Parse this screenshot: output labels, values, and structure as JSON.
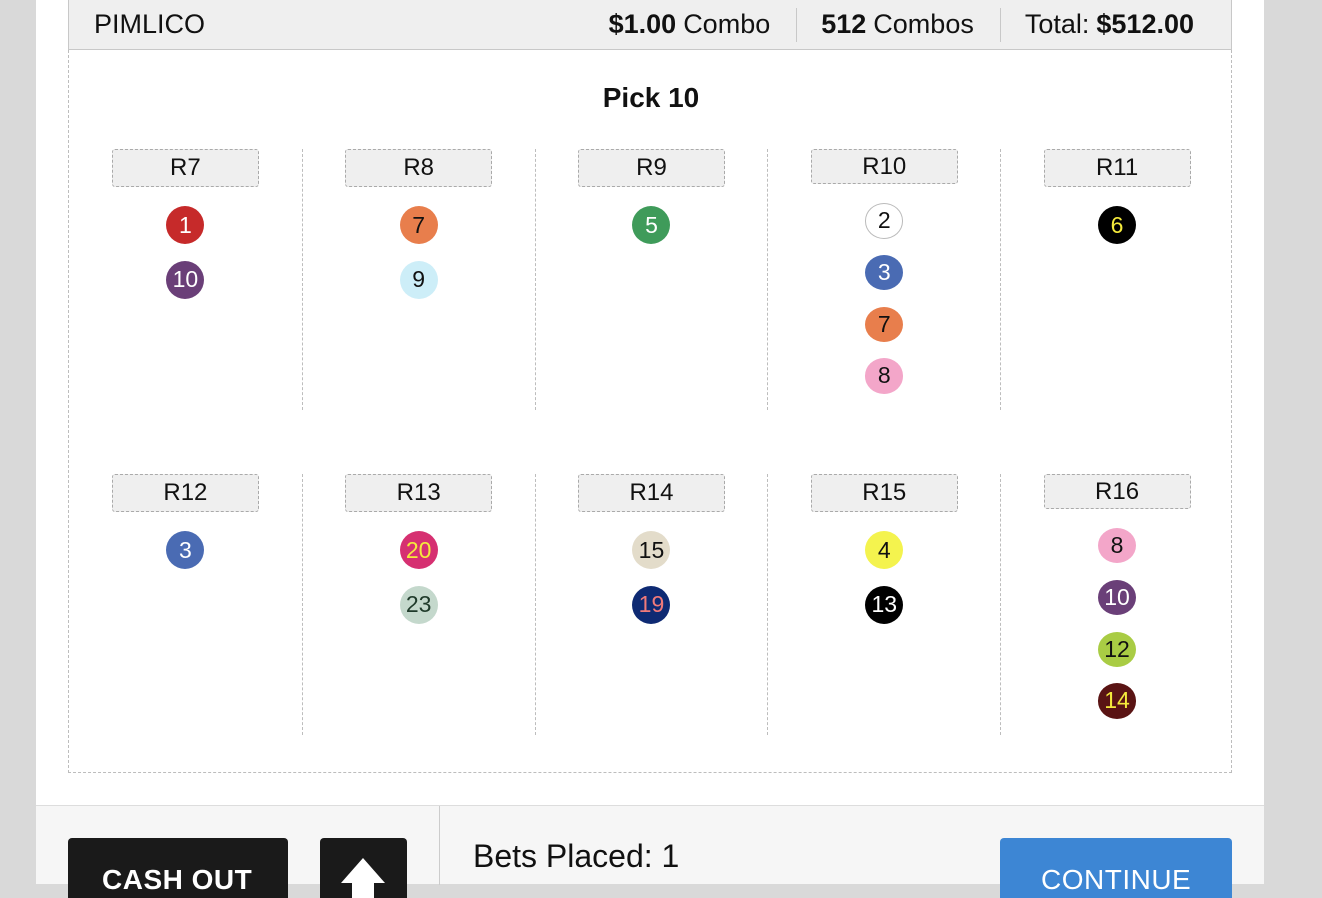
{
  "ticket": {
    "track": "PIMLICO",
    "combo_amount": "$1.00",
    "combo_label": "Combo",
    "combos_count": "512",
    "combos_label": "Combos",
    "total_label": "Total:",
    "total_amount": "$512.00",
    "bet_type": "Pick 10"
  },
  "races": [
    {
      "label": "R7",
      "runners": [
        {
          "num": "1",
          "bg": "#c62a2a",
          "fg": "#ffffff"
        },
        {
          "num": "10",
          "bg": "#6a3f78",
          "fg": "#ffffff"
        }
      ]
    },
    {
      "label": "R8",
      "runners": [
        {
          "num": "7",
          "bg": "#e87e4c",
          "fg": "#111111"
        },
        {
          "num": "9",
          "bg": "#cdeef8",
          "fg": "#111111"
        }
      ]
    },
    {
      "label": "R9",
      "runners": [
        {
          "num": "5",
          "bg": "#3f9b5a",
          "fg": "#ffffff"
        }
      ]
    },
    {
      "label": "R10",
      "runners": [
        {
          "num": "2",
          "bg": "#ffffff",
          "fg": "#111111",
          "border": "#bbbbbb"
        },
        {
          "num": "3",
          "bg": "#4a6bb3",
          "fg": "#ffffff"
        },
        {
          "num": "7",
          "bg": "#e87e4c",
          "fg": "#111111"
        },
        {
          "num": "8",
          "bg": "#f3a6c9",
          "fg": "#111111"
        }
      ]
    },
    {
      "label": "R11",
      "runners": [
        {
          "num": "6",
          "bg": "#000000",
          "fg": "#f4ea3c"
        }
      ]
    },
    {
      "label": "R12",
      "runners": [
        {
          "num": "3",
          "bg": "#4a6bb3",
          "fg": "#ffffff"
        }
      ]
    },
    {
      "label": "R13",
      "runners": [
        {
          "num": "20",
          "bg": "#d63071",
          "fg": "#f4ea3c"
        },
        {
          "num": "23",
          "bg": "#c4d8cc",
          "fg": "#1f3a2a"
        }
      ]
    },
    {
      "label": "R14",
      "runners": [
        {
          "num": "15",
          "bg": "#e3dcca",
          "fg": "#111111"
        },
        {
          "num": "19",
          "bg": "#0e2a73",
          "fg": "#f07a7a"
        }
      ]
    },
    {
      "label": "R15",
      "runners": [
        {
          "num": "4",
          "bg": "#f4f34e",
          "fg": "#111111"
        },
        {
          "num": "13",
          "bg": "#000000",
          "fg": "#ffffff"
        }
      ]
    },
    {
      "label": "R16",
      "runners": [
        {
          "num": "8",
          "bg": "#f3a6c9",
          "fg": "#111111"
        },
        {
          "num": "10",
          "bg": "#6a3f78",
          "fg": "#ffffff"
        },
        {
          "num": "12",
          "bg": "#a9cc44",
          "fg": "#111111"
        },
        {
          "num": "14",
          "bg": "#5a1414",
          "fg": "#f4ea3c"
        }
      ]
    }
  ],
  "footer": {
    "cash_out": "CASH OUT",
    "bets_placed": "Bets Placed: 1",
    "continue": "CONTINUE",
    "up_icon": "up-arrow-icon"
  }
}
